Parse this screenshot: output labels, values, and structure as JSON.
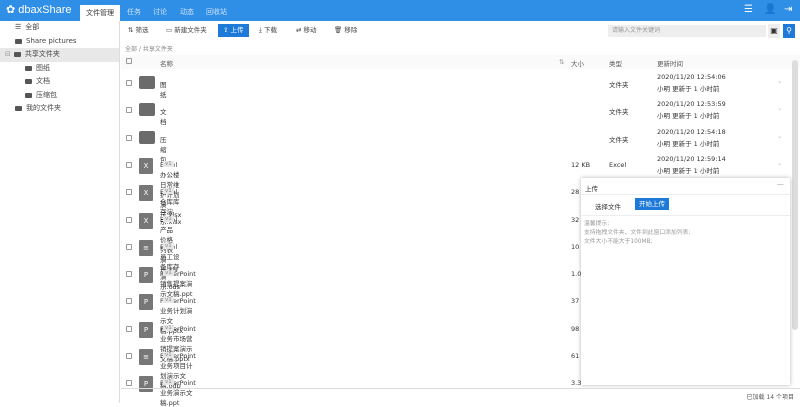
{
  "header": {
    "logo": "dbaxShare",
    "tabs": [
      {
        "label": "文件管理",
        "active": true
      },
      {
        "label": "任务"
      },
      {
        "label": "讨论"
      },
      {
        "label": "动态"
      },
      {
        "label": "回收站"
      }
    ],
    "accent": "#2f8ee5"
  },
  "sidebar": {
    "items": [
      {
        "label": "全部",
        "icon": "list-icon",
        "level": 0
      },
      {
        "label": "Share pictures",
        "level": 0
      },
      {
        "label": "共享文件夹",
        "level": 0,
        "selected": true
      },
      {
        "label": "图纸",
        "level": 1
      },
      {
        "label": "文档",
        "level": 1
      },
      {
        "label": "压缩包",
        "level": 1
      },
      {
        "label": "我的文件夹",
        "level": 0
      }
    ]
  },
  "toolbar": {
    "filter": "筛选",
    "new_folder": "新建文件夹",
    "upload": "上传",
    "download": "下载",
    "move": "移动",
    "remove": "移除",
    "search_placeholder": "请输入文件关键词"
  },
  "breadcrumb": "全部 / 共享文件夹",
  "columns": {
    "name": "名称",
    "size": "大小",
    "type": "类型",
    "updated": "更新时间"
  },
  "rows": [
    {
      "name": "图纸",
      "kind": "folder",
      "size": "",
      "type": "文件夹",
      "time": "2020/11/20 12:54:06",
      "by": "小明 更新于 1 小时前"
    },
    {
      "name": "文档",
      "kind": "folder",
      "size": "",
      "type": "文件夹",
      "time": "2020/11/20 12:53:59",
      "by": "小明 更新于 1 小时前"
    },
    {
      "name": "压缩包",
      "kind": "folder",
      "size": "",
      "type": "文件夹",
      "time": "2020/11/20 12:54:18",
      "by": "小明 更新于 1 小时前"
    },
    {
      "name": "Excel办公楼日常维护计划演示.xlsx",
      "kind": "excel",
      "ver": "v1",
      "size": "12 KB",
      "type": "Excel",
      "time": "2020/11/20 12:59:14",
      "by": "小明 更新于 1 小时前"
    },
    {
      "name": "Excel仓库库存演示.xlsx",
      "kind": "excel",
      "ver": "v1",
      "size": "28"
    },
    {
      "name": "Excel产品价格列表演示.xls",
      "kind": "excel",
      "ver": "v1",
      "size": "32"
    },
    {
      "name": "Excel员工设备库存演示.ods",
      "kind": "doc",
      "ver": "v1",
      "size": "10"
    },
    {
      "name": "PowerPoint销售提案演示文稿.ppt",
      "kind": "ppt",
      "ver": "v1",
      "size": "1.0"
    },
    {
      "name": "PowerPoint业务计划演示文稿.pptx",
      "kind": "ppt",
      "ver": "v1",
      "size": "37"
    },
    {
      "name": "PowerPoint业务市场营销提案演示文稿.pptx",
      "kind": "ppt",
      "ver": "v1",
      "size": "98"
    },
    {
      "name": "PowerPoint业务项目计划演示文稿.odp",
      "kind": "doc",
      "ver": "v1",
      "size": "61"
    },
    {
      "name": "PowerPoint业务演示文稿.ppt",
      "kind": "ppt",
      "ver": "v1",
      "size": "3.3"
    }
  ],
  "upload_panel": {
    "title": "上传",
    "choose": "选择文件",
    "start": "开始上传",
    "hint_title": "温馨提示:",
    "hint1": "支持拖拽文件夹、文件到此窗口添加列表;",
    "hint2": "文件大小不能大于100MB;"
  },
  "footer": "已加载 14 个项目"
}
